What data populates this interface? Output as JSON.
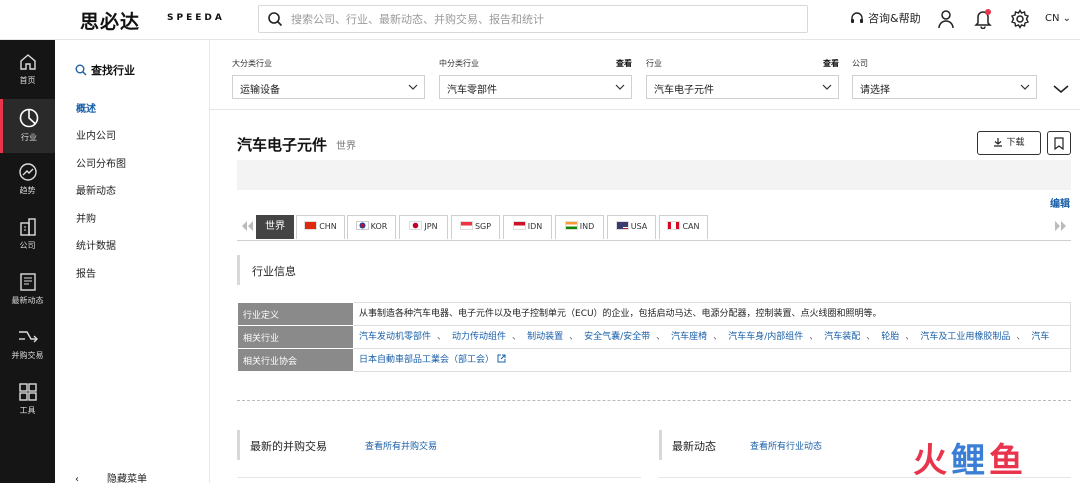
{
  "app": {
    "logo_cn": "思必达",
    "logo_en": "SPEEDA"
  },
  "search": {
    "placeholder": "搜索公司、行业、最新动态、并购交易、报告和统计"
  },
  "header": {
    "help_label": "咨询&帮助",
    "lang": "CN"
  },
  "leftnav": [
    {
      "label": "首页",
      "icon": "home-icon"
    },
    {
      "label": "行业",
      "icon": "industry-icon",
      "active": true
    },
    {
      "label": "趋势",
      "icon": "trend-icon"
    },
    {
      "label": "公司",
      "icon": "company-icon"
    },
    {
      "label": "最新动态",
      "icon": "news-icon"
    },
    {
      "label": "并购交易",
      "icon": "ma-icon"
    },
    {
      "label": "工具",
      "icon": "tools-icon"
    }
  ],
  "sidebar": {
    "title": "查找行业",
    "items": [
      "概述",
      "业内公司",
      "公司分布图",
      "最新动态",
      "并购",
      "统计数据",
      "报告"
    ],
    "hide_menu": "隐藏菜单"
  },
  "filters": [
    {
      "label": "大分类行业",
      "value": "运输设备",
      "view": ""
    },
    {
      "label": "中分类行业",
      "value": "汽车零部件",
      "view": "查看"
    },
    {
      "label": "行业",
      "value": "汽车电子元件",
      "view": "查看"
    },
    {
      "label": "公司",
      "value": "请选择",
      "view": ""
    }
  ],
  "page": {
    "title": "汽车电子元件",
    "subtitle": "世界",
    "download_label": "下载",
    "edit_label": "编辑"
  },
  "regions": [
    {
      "label": "世界",
      "flag": "",
      "active": true
    },
    {
      "label": "CHN",
      "flag": "#de2910"
    },
    {
      "label": "KOR",
      "flag": "#0047a0"
    },
    {
      "label": "JPN",
      "flag": "#bc002d"
    },
    {
      "label": "SGP",
      "flag": "#ef3340"
    },
    {
      "label": "IDN",
      "flag": "#ce1126"
    },
    {
      "label": "IND",
      "flag": "#ff9933"
    },
    {
      "label": "USA",
      "flag": "#3c3b6e"
    },
    {
      "label": "CAN",
      "flag": "#d80621"
    }
  ],
  "industry_info": {
    "section_title": "行业信息",
    "definition_label": "行业定义",
    "definition": "从事制造各种汽车电器、电子元件以及电子控制单元（ECU）的企业，包括启动马达、电源分配器，控制装置、点火线圈和照明等。",
    "related_label": "相关行业",
    "related": [
      "汽车发动机零部件",
      "动力传动组件",
      "制动装置",
      "安全气囊/安全带",
      "汽车座椅",
      "汽车车身/内部组件",
      "汽车装配",
      "轮胎",
      "汽车及工业用橡胶制品",
      "汽车"
    ],
    "association_label": "相关行业协会",
    "association": "日本自動車部品工業会（部工会）"
  },
  "cards": {
    "ma_title": "最新的并购交易",
    "ma_link": "查看所有并购交易",
    "news_title": "最新动态",
    "news_link": "查看所有行业动态"
  },
  "watermark": {
    "left": "火",
    "mid": "鲤",
    "right": "鱼"
  }
}
